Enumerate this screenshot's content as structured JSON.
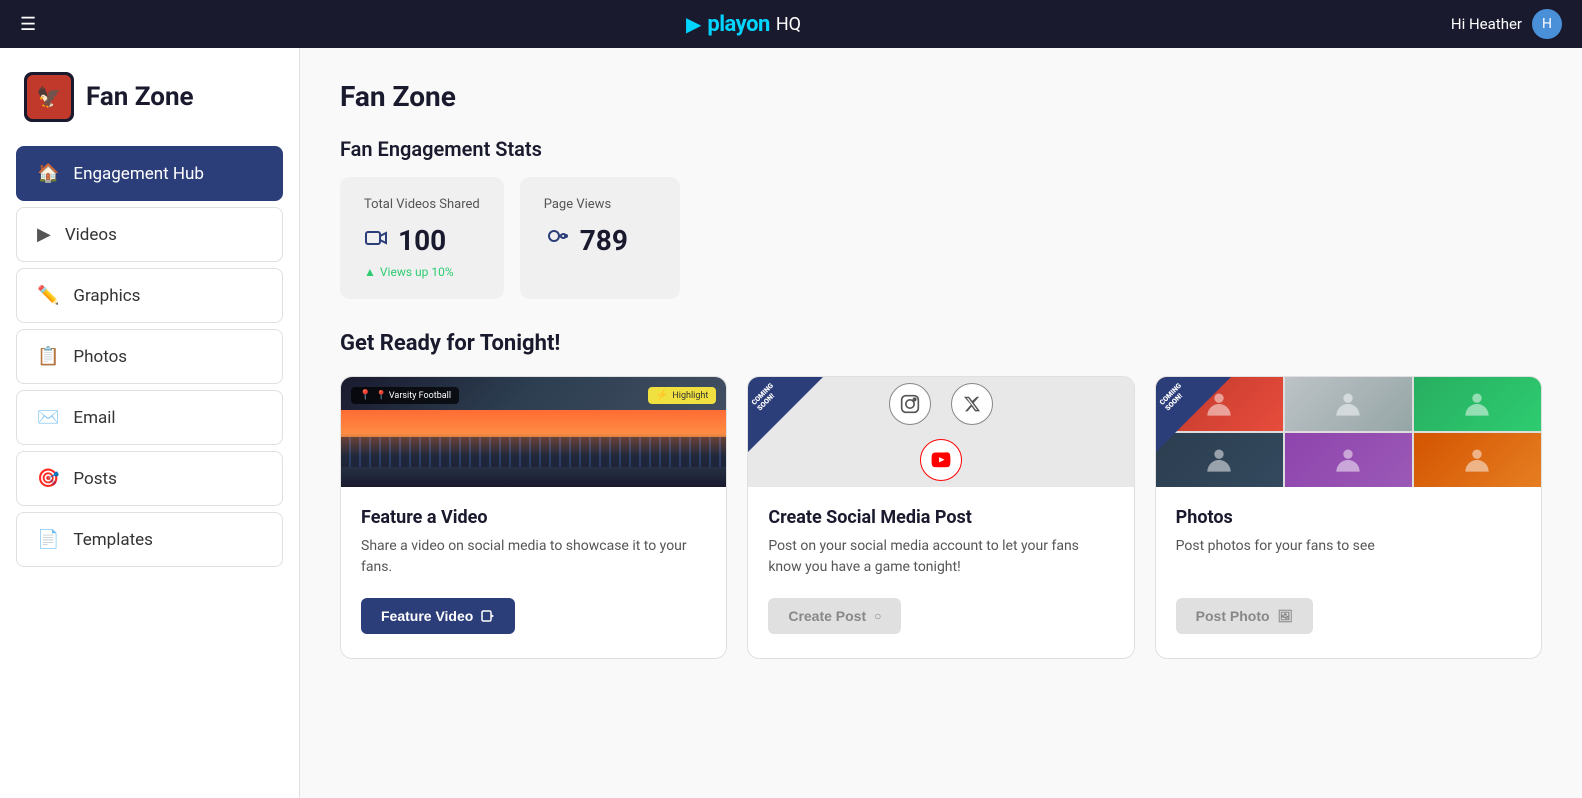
{
  "topnav": {
    "logo_arrow": "▶",
    "logo_playon": "playon",
    "logo_hq": "HQ",
    "greeting": "Hi Heather",
    "user_initial": "H"
  },
  "sidebar": {
    "brand_name": "Fan Zone",
    "items": [
      {
        "id": "engagement-hub",
        "label": "Engagement Hub",
        "icon": "🏠",
        "active": true
      },
      {
        "id": "videos",
        "label": "Videos",
        "icon": "▶",
        "active": false
      },
      {
        "id": "graphics",
        "label": "Graphics",
        "icon": "✏️",
        "active": false
      },
      {
        "id": "photos",
        "label": "Photos",
        "icon": "📋",
        "active": false
      },
      {
        "id": "email",
        "label": "Email",
        "icon": "✉️",
        "active": false
      },
      {
        "id": "posts",
        "label": "Posts",
        "icon": "🎯",
        "active": false
      },
      {
        "id": "templates",
        "label": "Templates",
        "icon": "📄",
        "active": false
      }
    ]
  },
  "main": {
    "page_title": "Fan Zone",
    "stats": {
      "section_title": "Fan Engagement Stats",
      "total_videos": {
        "label": "Total Videos Shared",
        "value": "100",
        "sub_text": "Views up 10%"
      },
      "page_views": {
        "label": "Page Views",
        "value": "789"
      }
    },
    "ready": {
      "section_title": "Get Ready for Tonight!",
      "cards": [
        {
          "id": "feature-video",
          "tag_left": "📍 Varsity Football",
          "tag_right": "⚡ Highlight",
          "heading": "Feature a Video",
          "desc": "Share a video on social media to showcase it to your fans.",
          "button_label": "Feature Video",
          "button_icon": "▶",
          "button_type": "primary"
        },
        {
          "id": "create-post",
          "heading": "Create Social Media Post",
          "desc": "Post on your social media account to let your fans know you have a game tonight!",
          "button_label": "Create Post",
          "button_icon": "○",
          "button_type": "secondary",
          "coming_soon": true
        },
        {
          "id": "photos",
          "heading": "Photos",
          "desc": "Post photos for your fans to see",
          "button_label": "Post Photo",
          "button_icon": "□",
          "button_type": "secondary",
          "coming_soon": true
        }
      ]
    }
  }
}
